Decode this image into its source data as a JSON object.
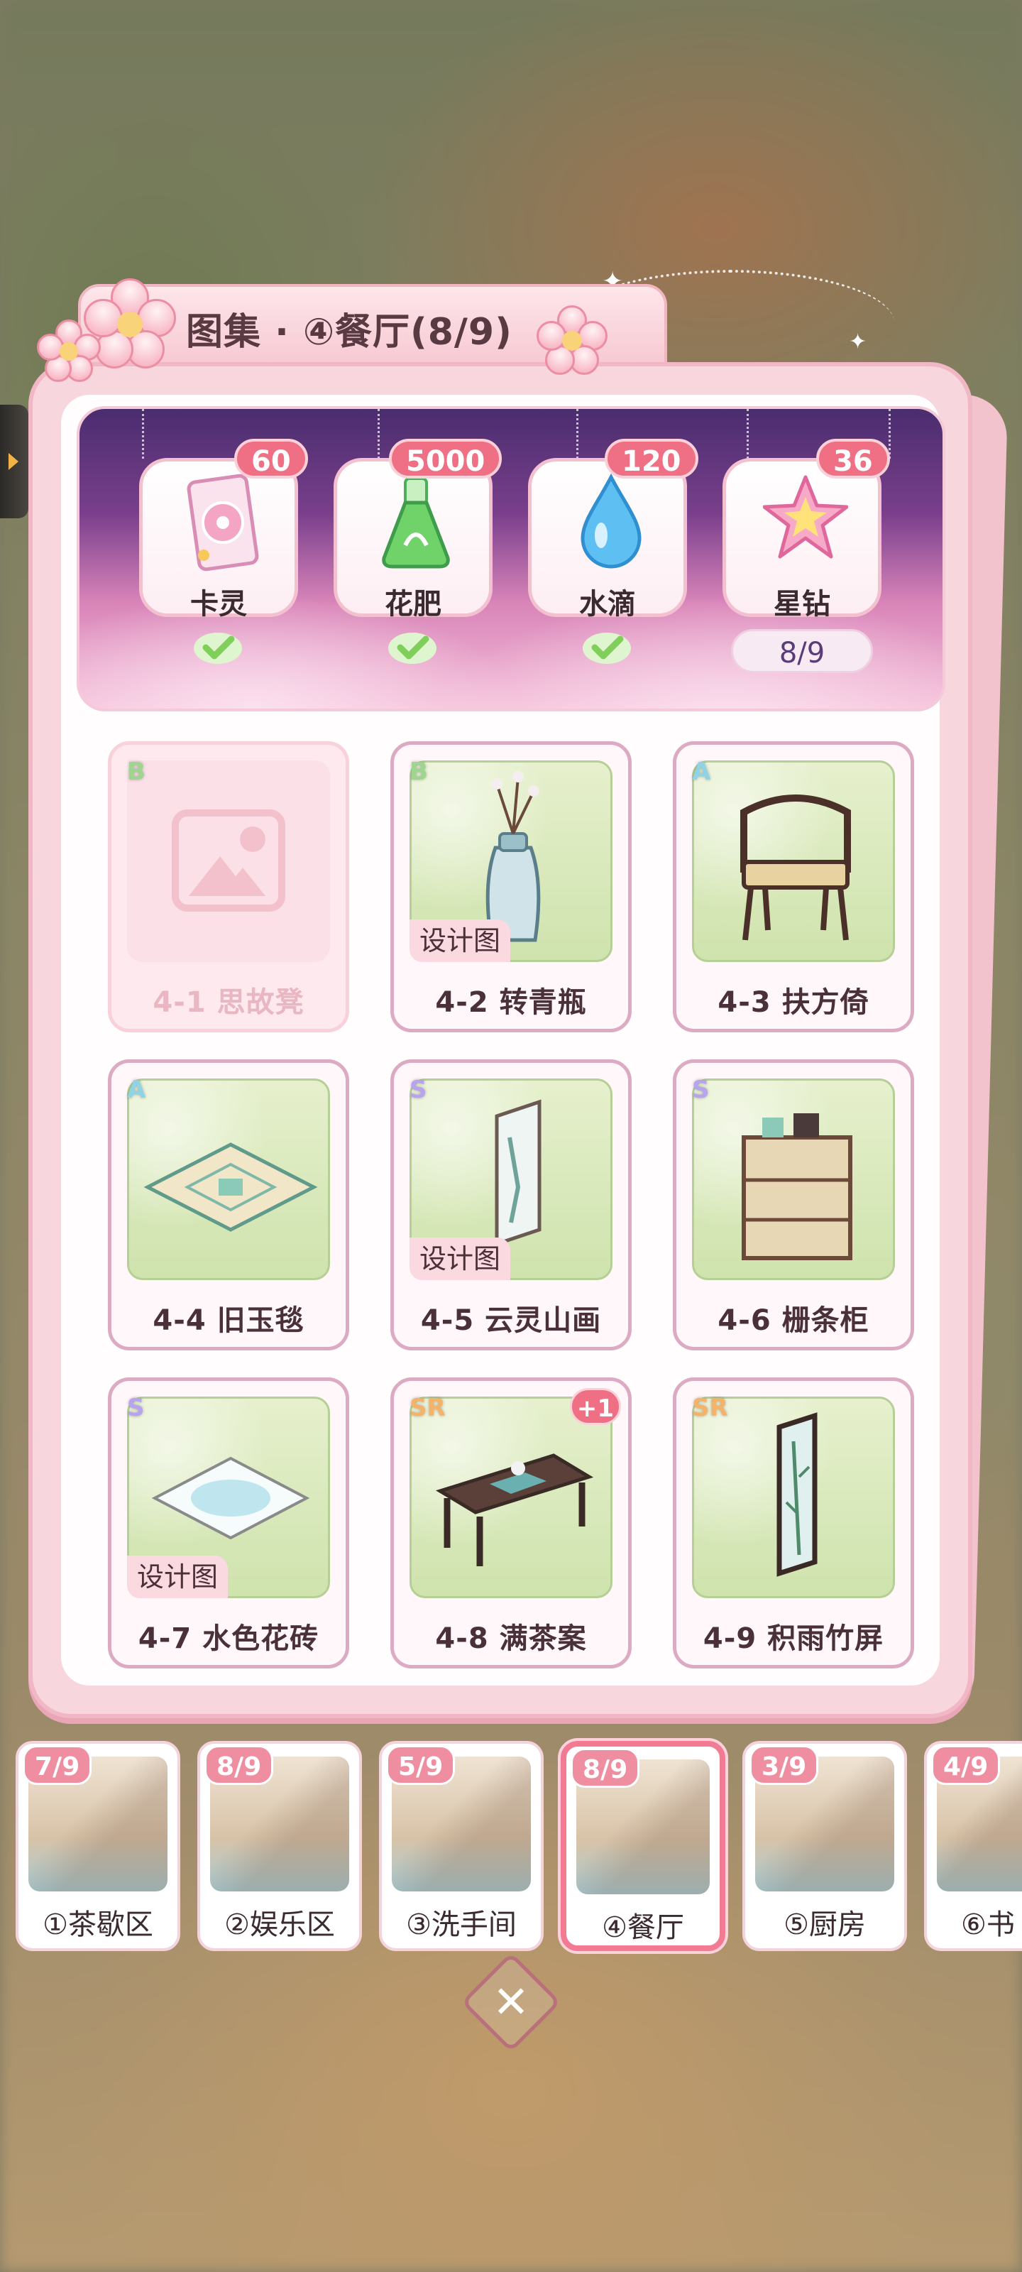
{
  "title": "图集 · ④餐厅(8/9)",
  "rewards": [
    {
      "label": "卡灵",
      "count": "60",
      "icon": "card-icon",
      "claimed": true
    },
    {
      "label": "花肥",
      "count": "5000",
      "icon": "fertilizer-flask-icon",
      "claimed": true
    },
    {
      "label": "水滴",
      "count": "120",
      "icon": "water-drop-icon",
      "claimed": true
    },
    {
      "label": "星钻",
      "count": "36",
      "icon": "star-diamond-icon",
      "claimed": false
    }
  ],
  "reward_progress": "8/9",
  "items": [
    {
      "name": "4-1 思故凳",
      "rarity": "B",
      "locked": true
    },
    {
      "name": "4-2 转青瓶",
      "rarity": "B",
      "tag": "设计图"
    },
    {
      "name": "4-3 扶方倚",
      "rarity": "A"
    },
    {
      "name": "4-4 旧玉毯",
      "rarity": "A"
    },
    {
      "name": "4-5 云灵山画",
      "rarity": "S",
      "tag": "设计图"
    },
    {
      "name": "4-6 栅条柜",
      "rarity": "S"
    },
    {
      "name": "4-7 水色花砖",
      "rarity": "S",
      "tag": "设计图"
    },
    {
      "name": "4-8 满茶案",
      "rarity": "SR",
      "badge": "+1"
    },
    {
      "name": "4-9 积雨竹屏",
      "rarity": "SR"
    }
  ],
  "rooms": [
    {
      "label": "①茶歇区",
      "progress": "7/9"
    },
    {
      "label": "②娱乐区",
      "progress": "8/9"
    },
    {
      "label": "③洗手间",
      "progress": "5/9"
    },
    {
      "label": "④餐厅",
      "progress": "8/9",
      "active": true
    },
    {
      "label": "⑤厨房",
      "progress": "3/9"
    },
    {
      "label": "⑥书",
      "progress": "4/9"
    }
  ],
  "close_icon": "close-x-icon",
  "colors": {
    "accent_pink": "#ef6f84",
    "panel_pink": "#f8d6dd",
    "check_green": "#7fcf5a"
  }
}
